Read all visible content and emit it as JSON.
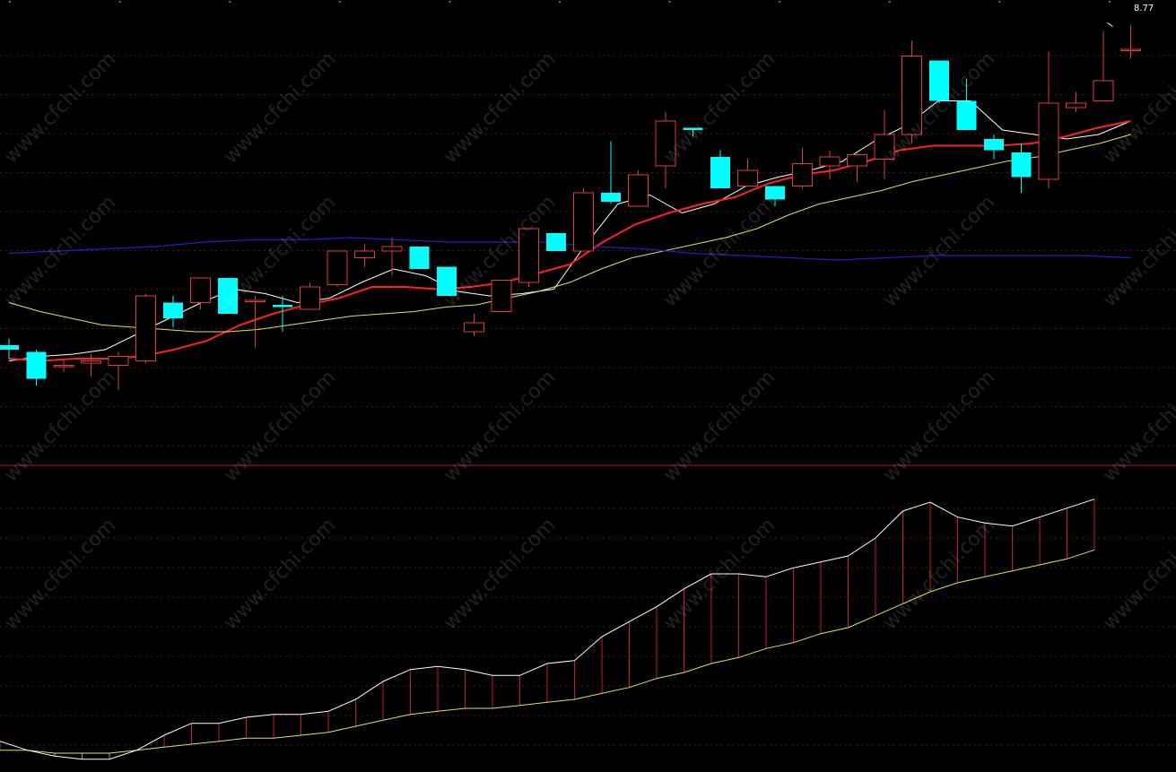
{
  "high_label": "8.77",
  "watermark": "www.cfchi.com",
  "colors": {
    "background": "#000000",
    "up": "#e03a3a",
    "down": "#00ffff",
    "ma_white": "#ffffff",
    "ma_red": "#ff2020",
    "ma_yellow": "#e0e060",
    "ma_blue": "#2020c8",
    "hist_pos": "#c02020",
    "hist_neg": "#40d040",
    "grid": "#6a0f0f",
    "divider": "#b02020"
  },
  "chart_data": [
    {
      "type": "candlestick",
      "candles": [
        {
          "o": 7.34,
          "h": 7.37,
          "l": 7.28,
          "c": 7.32
        },
        {
          "o": 7.31,
          "h": 7.32,
          "l": 7.16,
          "c": 7.19
        },
        {
          "o": 7.25,
          "h": 7.28,
          "l": 7.22,
          "c": 7.25
        },
        {
          "o": 7.26,
          "h": 7.3,
          "l": 7.2,
          "c": 7.27
        },
        {
          "o": 7.25,
          "h": 7.31,
          "l": 7.14,
          "c": 7.29
        },
        {
          "o": 7.27,
          "h": 7.57,
          "l": 7.26,
          "c": 7.56
        },
        {
          "o": 7.53,
          "h": 7.56,
          "l": 7.42,
          "c": 7.46
        },
        {
          "o": 7.53,
          "h": 7.64,
          "l": 7.5,
          "c": 7.64
        },
        {
          "o": 7.64,
          "h": 7.64,
          "l": 7.48,
          "c": 7.48
        },
        {
          "o": 7.54,
          "h": 7.56,
          "l": 7.33,
          "c": 7.54
        },
        {
          "o": 7.52,
          "h": 7.56,
          "l": 7.4,
          "c": 7.51
        },
        {
          "o": 7.5,
          "h": 7.62,
          "l": 7.5,
          "c": 7.6
        },
        {
          "o": 7.61,
          "h": 7.76,
          "l": 7.6,
          "c": 7.76
        },
        {
          "o": 7.73,
          "h": 7.79,
          "l": 7.69,
          "c": 7.76
        },
        {
          "o": 7.76,
          "h": 7.82,
          "l": 7.65,
          "c": 7.78
        },
        {
          "o": 7.78,
          "h": 7.78,
          "l": 7.68,
          "c": 7.68
        },
        {
          "o": 7.69,
          "h": 7.69,
          "l": 7.56,
          "c": 7.56
        },
        {
          "o": 7.4,
          "h": 7.48,
          "l": 7.38,
          "c": 7.44
        },
        {
          "o": 7.49,
          "h": 7.63,
          "l": 7.49,
          "c": 7.63
        },
        {
          "o": 7.62,
          "h": 7.86,
          "l": 7.6,
          "c": 7.86
        },
        {
          "o": 7.84,
          "h": 7.84,
          "l": 7.76,
          "c": 7.76
        },
        {
          "o": 7.76,
          "h": 8.04,
          "l": 7.76,
          "c": 8.02
        },
        {
          "o": 8.02,
          "h": 8.25,
          "l": 7.97,
          "c": 7.98
        },
        {
          "o": 7.96,
          "h": 8.12,
          "l": 7.96,
          "c": 8.1
        },
        {
          "o": 8.14,
          "h": 8.38,
          "l": 8.04,
          "c": 8.34
        },
        {
          "o": 8.31,
          "h": 8.31,
          "l": 8.27,
          "c": 8.3
        },
        {
          "o": 8.18,
          "h": 8.21,
          "l": 8.04,
          "c": 8.04
        },
        {
          "o": 8.05,
          "h": 8.17,
          "l": 8.05,
          "c": 8.12
        },
        {
          "o": 8.05,
          "h": 8.05,
          "l": 7.96,
          "c": 7.99
        },
        {
          "o": 8.05,
          "h": 8.22,
          "l": 8.04,
          "c": 8.15
        },
        {
          "o": 8.14,
          "h": 8.21,
          "l": 8.08,
          "c": 8.18
        },
        {
          "o": 8.14,
          "h": 8.2,
          "l": 8.07,
          "c": 8.19
        },
        {
          "o": 8.17,
          "h": 8.39,
          "l": 8.08,
          "c": 8.28
        },
        {
          "o": 8.28,
          "h": 8.7,
          "l": 8.24,
          "c": 8.63
        },
        {
          "o": 8.61,
          "h": 8.61,
          "l": 8.42,
          "c": 8.43
        },
        {
          "o": 8.43,
          "h": 8.53,
          "l": 8.3,
          "c": 8.3
        },
        {
          "o": 8.26,
          "h": 8.28,
          "l": 8.17,
          "c": 8.21
        },
        {
          "o": 8.2,
          "h": 8.24,
          "l": 8.02,
          "c": 8.09
        },
        {
          "o": 8.08,
          "h": 8.65,
          "l": 8.04,
          "c": 8.42
        },
        {
          "o": 8.4,
          "h": 8.47,
          "l": 8.38,
          "c": 8.42
        },
        {
          "o": 8.43,
          "h": 8.74,
          "l": 8.43,
          "c": 8.52
        },
        {
          "o": 8.66,
          "h": 8.77,
          "l": 8.62,
          "c": 8.66
        }
      ],
      "ma": [
        {
          "name": "white",
          "values": [
            7.27,
            7.29,
            7.3,
            7.32,
            7.39,
            7.46,
            7.53,
            7.59,
            7.57,
            7.53,
            7.55,
            7.62,
            7.68,
            7.65,
            7.58,
            7.56,
            7.57,
            7.59,
            7.79,
            7.97,
            8.01,
            7.93,
            7.97,
            8.05,
            8.09,
            8.12,
            8.16,
            8.25,
            8.32,
            8.43,
            8.43,
            8.3,
            8.28,
            8.26,
            8.28,
            8.34
          ]
        },
        {
          "name": "red",
          "values": [
            7.28,
            7.27,
            7.28,
            7.28,
            7.29,
            7.32,
            7.36,
            7.43,
            7.48,
            7.52,
            7.55,
            7.6,
            7.6,
            7.59,
            7.6,
            7.62,
            7.66,
            7.7,
            7.8,
            7.88,
            7.93,
            7.97,
            8.0,
            8.06,
            8.1,
            8.12,
            8.16,
            8.21,
            8.23,
            8.23,
            8.23,
            8.24,
            8.27,
            8.31,
            8.34
          ]
        },
        {
          "name": "yellow",
          "values": [
            7.53,
            7.49,
            7.46,
            7.43,
            7.42,
            7.41,
            7.4,
            7.4,
            7.41,
            7.43,
            7.45,
            7.47,
            7.48,
            7.49,
            7.51,
            7.52,
            7.55,
            7.58,
            7.62,
            7.68,
            7.73,
            7.76,
            7.79,
            7.82,
            7.86,
            7.92,
            7.97,
            8.0,
            8.03,
            8.07,
            8.1,
            8.13,
            8.16,
            8.18,
            8.21,
            8.24,
            8.28
          ]
        },
        {
          "name": "blue",
          "values": [
            7.75,
            7.76,
            7.77,
            7.78,
            7.8,
            7.81,
            7.81,
            7.82,
            7.81,
            7.8,
            7.8,
            7.8,
            7.78,
            7.77,
            7.75,
            7.74,
            7.73,
            7.72,
            7.73,
            7.74,
            7.74,
            7.74,
            7.74,
            7.73
          ]
        }
      ],
      "ylim": [
        7.0,
        8.8
      ]
    },
    {
      "type": "bar",
      "macd": [
        -0.38,
        -0.41,
        -0.43,
        -0.44,
        -0.44,
        -0.41,
        -0.36,
        -0.32,
        -0.32,
        -0.3,
        -0.29,
        -0.29,
        -0.28,
        -0.24,
        -0.18,
        -0.14,
        -0.13,
        -0.14,
        -0.16,
        -0.16,
        -0.12,
        -0.11,
        -0.03,
        0.02,
        0.07,
        0.13,
        0.18,
        0.18,
        0.17,
        0.2,
        0.22,
        0.24,
        0.3,
        0.39,
        0.42,
        0.37,
        0.35,
        0.34,
        0.37,
        0.4,
        0.43
      ],
      "signal": [
        -0.41,
        -0.41,
        -0.42,
        -0.42,
        -0.42,
        -0.41,
        -0.4,
        -0.39,
        -0.38,
        -0.37,
        -0.37,
        -0.36,
        -0.35,
        -0.33,
        -0.31,
        -0.29,
        -0.28,
        -0.27,
        -0.27,
        -0.26,
        -0.25,
        -0.24,
        -0.22,
        -0.2,
        -0.17,
        -0.15,
        -0.12,
        -0.1,
        -0.07,
        -0.05,
        -0.02,
        0.0,
        0.04,
        0.08,
        0.12,
        0.15,
        0.17,
        0.19,
        0.21,
        0.23,
        0.26
      ],
      "ylim": [
        -0.48,
        0.48
      ]
    }
  ]
}
